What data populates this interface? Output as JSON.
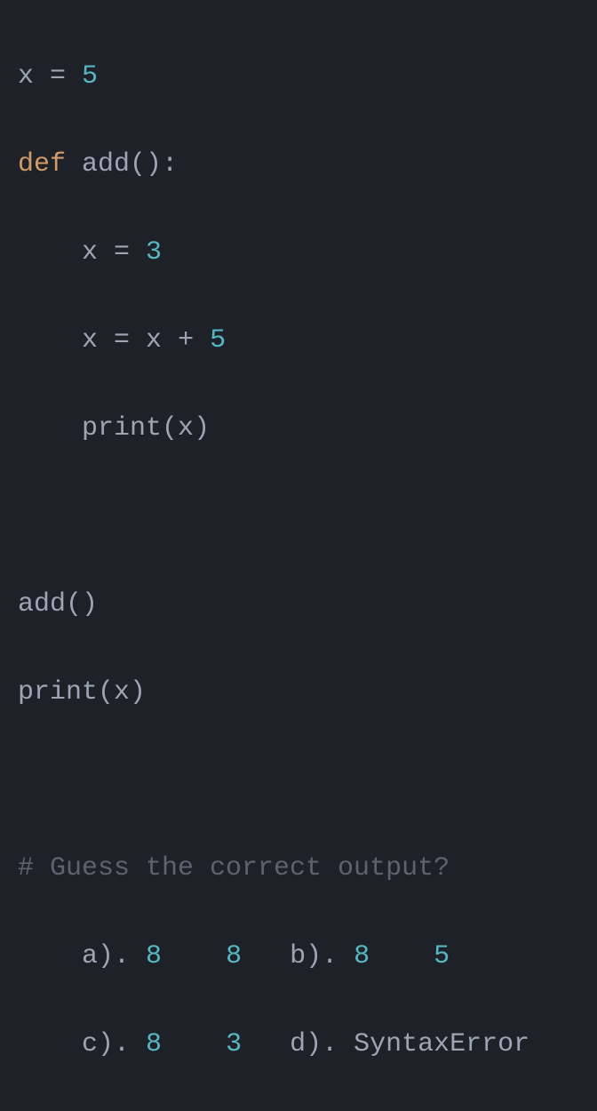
{
  "code": {
    "line1_var": "x",
    "line1_eq": " = ",
    "line1_val": "5",
    "line2_kw": "def",
    "line2_sp": " ",
    "line2_fn": "add",
    "line2_paren": "()",
    "line2_colon": ":",
    "line3_indent": "    ",
    "line3_var": "x",
    "line3_eq": " = ",
    "line3_val": "3",
    "line4_indent": "    ",
    "line4_var": "x",
    "line4_eq": " = ",
    "line4_var2": "x",
    "line4_op": " + ",
    "line4_val": "5",
    "line5_indent": "    ",
    "line5_fn": "print",
    "line5_open": "(",
    "line5_arg": "x",
    "line5_close": ")",
    "line6_fn": "add",
    "line6_paren": "()",
    "line7_fn": "print",
    "line7_open": "(",
    "line7_arg": "x",
    "line7_close": ")"
  },
  "question": {
    "comment": "# Guess the correct output?"
  },
  "answers": {
    "a_indent": "    ",
    "a_label": "a). ",
    "a_v1": "8",
    "a_gap1": "    ",
    "a_v2": "8",
    "ab_gap": "   ",
    "b_label": "b). ",
    "b_v1": "8",
    "b_gap1": "    ",
    "b_v2": "5",
    "c_indent": "    ",
    "c_label": "c). ",
    "c_v1": "8",
    "c_gap1": "    ",
    "c_v2": "3",
    "cd_gap": "   ",
    "d_label": "d). ",
    "d_err": "SyntaxError"
  }
}
